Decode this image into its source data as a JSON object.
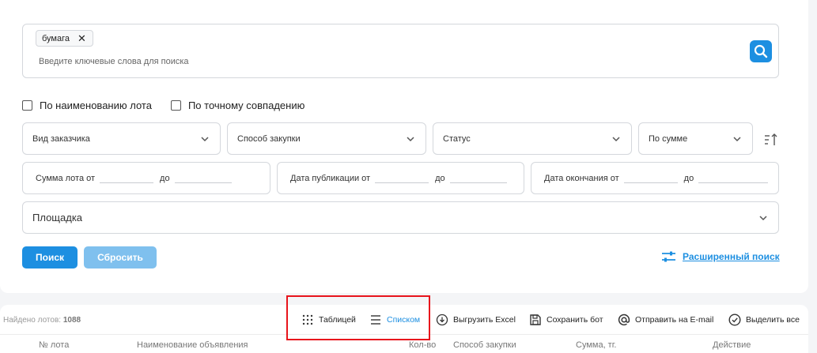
{
  "search": {
    "tag": "бумага",
    "placeholder": "Введите ключевые слова для поиска"
  },
  "checkboxes": {
    "by_lot_name": "По наименованию лота",
    "exact_match": "По точному совпадению"
  },
  "selects": {
    "customer_type": "Вид заказчика",
    "procurement_method": "Способ закупки",
    "status": "Статус",
    "sort_by": "По сумме"
  },
  "ranges": {
    "lot_sum_from": "Сумма лота от",
    "pub_date_from": "Дата публикации от",
    "end_date_from": "Дата окончания от",
    "to": "до"
  },
  "platform": "Площадка",
  "buttons": {
    "search": "Поиск",
    "reset": "Сбросить",
    "advanced": "Расширенный поиск"
  },
  "results": {
    "found_label": "Найдено лотов:",
    "found_count": "1088",
    "toolbar": {
      "table": "Таблицей",
      "list": "Списком",
      "excel": "Выгрузить Excel",
      "save_bot": "Сохранить бот",
      "email": "Отправить на E-mail",
      "select_all": "Выделить все"
    },
    "columns": {
      "lot_no": "№ лота",
      "name": "Наименование объявления",
      "qty": "Кол-во",
      "method": "Способ закупки",
      "sum": "Сумма, тг.",
      "action": "Действие"
    }
  },
  "colors": {
    "accent": "#1d8fe1",
    "accent_disabled": "#7fc0ee",
    "highlight": "#e8141c"
  }
}
